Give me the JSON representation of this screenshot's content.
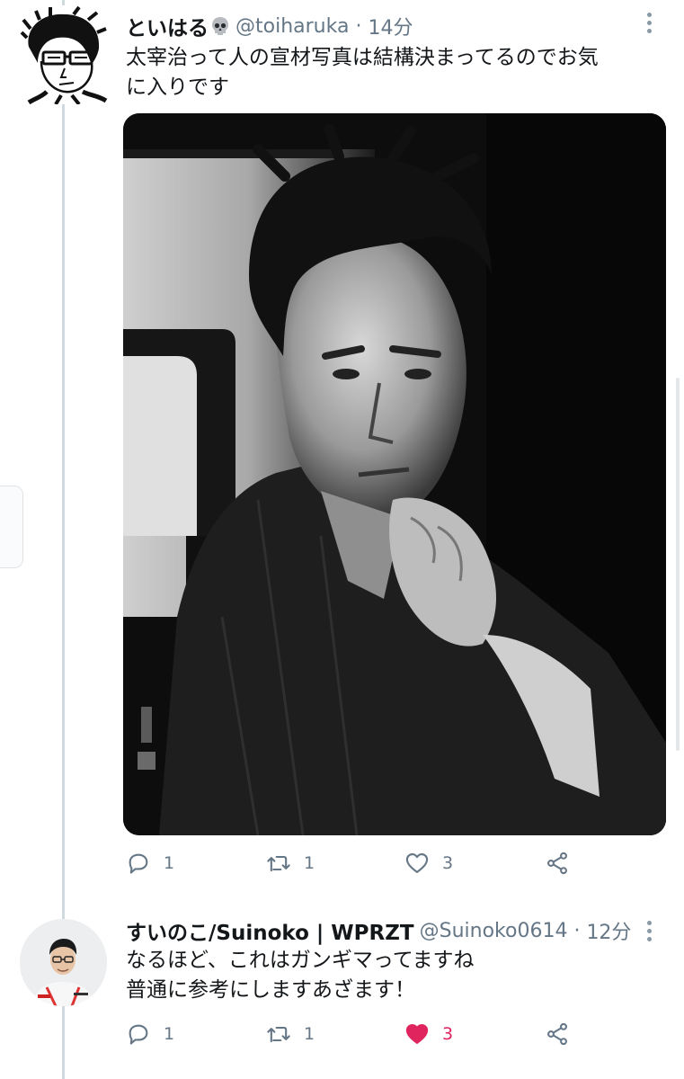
{
  "tweets": [
    {
      "display_name": "といはる",
      "handle": "@toiharuka",
      "separator": "·",
      "time": "14分",
      "text_lines": [
        "太宰治って人の宣材写真は結構決まってるのでお気",
        "に入りです"
      ],
      "replies": "1",
      "retweets": "1",
      "likes": "3",
      "liked": false
    },
    {
      "display_name": "すいのこ/Suinoko | WPRZT",
      "handle": "@Suinoko0614",
      "separator": "·",
      "time": "12分",
      "text_lines": [
        "なるほど、これはガンギマってますね",
        "普通に参考にしますあざます！"
      ],
      "replies": "1",
      "retweets": "1",
      "likes": "3",
      "liked": true
    }
  ],
  "colors": {
    "text": "#14171a",
    "secondary": "#657786",
    "like_active": "#e0245e",
    "thread_line": "#cfd9de"
  },
  "icons": [
    "skull-icon",
    "more-icon",
    "reply-icon",
    "retweet-icon",
    "like-icon",
    "share-icon"
  ]
}
